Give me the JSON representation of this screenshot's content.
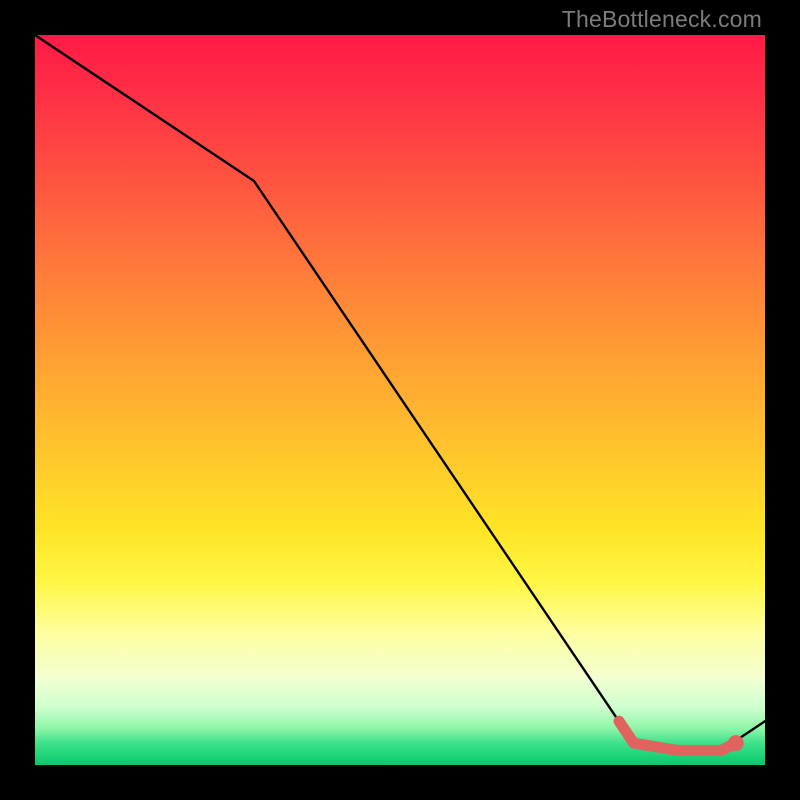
{
  "watermark": "TheBottleneck.com",
  "chart_data": {
    "type": "line",
    "title": "",
    "xlabel": "",
    "ylabel": "",
    "xlim": [
      0,
      100
    ],
    "ylim": [
      0,
      100
    ],
    "series": [
      {
        "name": "curve",
        "x": [
          0,
          30,
          82,
          88,
          94,
          100
        ],
        "y": [
          100,
          80,
          3,
          2,
          2,
          6
        ]
      }
    ],
    "highlight_segment": {
      "color": "#e0635f",
      "x": [
        80,
        82,
        88,
        94,
        96
      ],
      "y": [
        6,
        3,
        2,
        2,
        3
      ]
    }
  }
}
